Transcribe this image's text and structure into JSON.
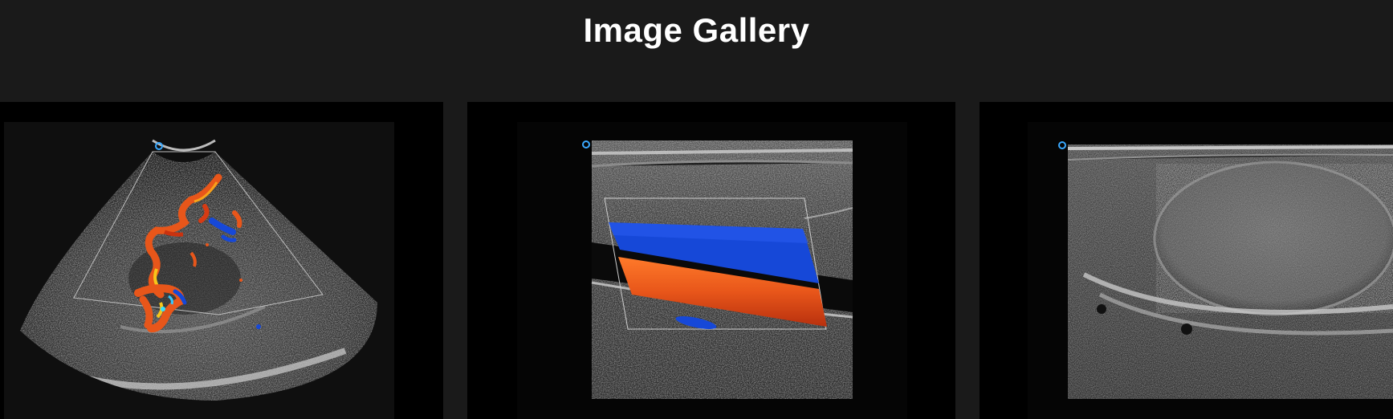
{
  "header": {
    "title": "Image Gallery"
  },
  "gallery": {
    "images": [
      {
        "name": "pediatric-cardiac-color-doppler",
        "kind": "sector color doppler ultrasound"
      },
      {
        "name": "carotid-artery-color-doppler",
        "kind": "linear color doppler ultrasound"
      },
      {
        "name": "testicular-ultrasound",
        "kind": "linear grayscale ultrasound"
      }
    ]
  },
  "colors": {
    "page_background": "#1a1a1a",
    "card_background": "#000000",
    "doppler_red": "#e8561a",
    "doppler_blue": "#1648d8",
    "title_text": "#ffffff"
  }
}
